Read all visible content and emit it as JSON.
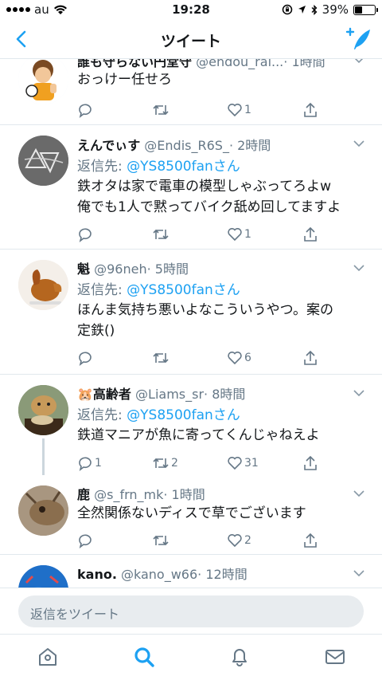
{
  "status_bar": {
    "carrier": "au",
    "time": "19:28",
    "battery": "39%",
    "battery_level": 0.39
  },
  "header": {
    "title": "ツイート"
  },
  "tweets": [
    {
      "name": "誰も守らない円堂守",
      "handle": "@endou_rai...",
      "time": "· 1時間",
      "reply_to_label": "",
      "reply_to_link": "",
      "text": "おっけー任せろ",
      "replies": "",
      "retweets": "",
      "likes": "1"
    },
    {
      "name": "えんでぃす",
      "handle": "@Endis_R6S_",
      "time": "· 2時間",
      "reply_to_label": "返信先: ",
      "reply_to_link": "@YS8500fanさん",
      "text": "鉄オタは家で電車の模型しゃぶってろよw\n俺でも1人で黙ってバイク舐め回してますよ",
      "replies": "",
      "retweets": "",
      "likes": "1"
    },
    {
      "name": "魁",
      "handle": "@96neh",
      "time": "· 5時間",
      "reply_to_label": "返信先: ",
      "reply_to_link": "@YS8500fanさん",
      "text": "ほんま気持ち悪いよなこういうやつ。案の\n定鉄()",
      "replies": "",
      "retweets": "",
      "likes": "6"
    },
    {
      "name": "高齢者",
      "name_prefix": "🐹",
      "handle": "@Liams_sr",
      "time": "· 8時間",
      "reply_to_label": "返信先: ",
      "reply_to_link": "@YS8500fanさん",
      "text": "鉄道マニアが魚に寄ってくんじゃねえよ",
      "replies": "1",
      "retweets": "2",
      "likes": "31"
    },
    {
      "name": "鹿",
      "handle": "@s_frn_mk",
      "time": "· 1時間",
      "reply_to_label": "",
      "reply_to_link": "",
      "text": "全然関係ないディスで草でございます",
      "replies": "",
      "retweets": "",
      "likes": "2"
    },
    {
      "name": "kano.",
      "handle": "@kano_w66",
      "time": "· 12時間",
      "reply_to_label": "",
      "reply_to_link": "",
      "text": "",
      "replies": "",
      "retweets": "",
      "likes": ""
    }
  ],
  "reply_bar": {
    "placeholder": "返信をツイート"
  },
  "tabs": [
    "home",
    "search",
    "notifications",
    "messages"
  ],
  "colors": {
    "accent": "#1da1f2",
    "muted": "#657786",
    "border": "#e1e8ed"
  }
}
